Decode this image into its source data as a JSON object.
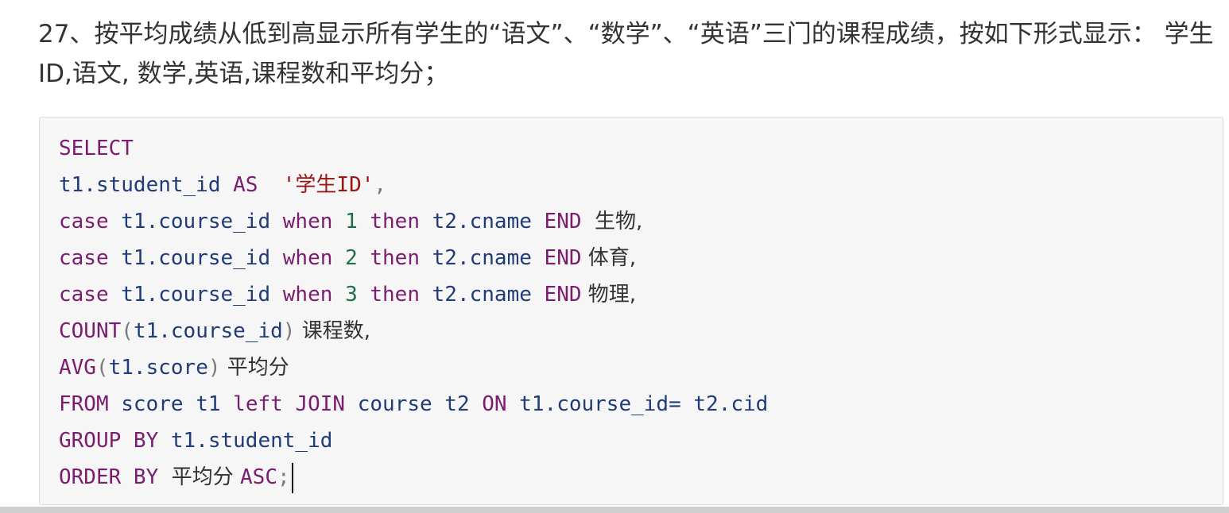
{
  "question": {
    "text": "27、按平均成绩从低到高显示所有学生的“语文”、“数学”、“英语”三门的课程成绩，按如下形式显示： 学生ID,语文, 数学,英语,课程数和平均分；"
  },
  "code": {
    "lines": [
      [
        {
          "t": "SELECT",
          "c": "kw"
        }
      ],
      [
        {
          "t": "t1.student_id ",
          "c": "id"
        },
        {
          "t": "AS",
          "c": "kw"
        },
        {
          "t": "  ",
          "c": "id"
        },
        {
          "t": "'学生ID'",
          "c": "str"
        },
        {
          "t": ",",
          "c": "p"
        }
      ],
      [
        {
          "t": "case",
          "c": "kw"
        },
        {
          "t": " t1.course_id ",
          "c": "id"
        },
        {
          "t": "when",
          "c": "kw"
        },
        {
          "t": " ",
          "c": "id"
        },
        {
          "t": "1",
          "c": "num"
        },
        {
          "t": " ",
          "c": "id"
        },
        {
          "t": "then",
          "c": "kw"
        },
        {
          "t": " t2.cname ",
          "c": "id"
        },
        {
          "t": "END",
          "c": "kw"
        },
        {
          "t": "  生物,",
          "c": "txt"
        }
      ],
      [
        {
          "t": "case",
          "c": "kw"
        },
        {
          "t": " t1.course_id ",
          "c": "id"
        },
        {
          "t": "when",
          "c": "kw"
        },
        {
          "t": " ",
          "c": "id"
        },
        {
          "t": "2",
          "c": "num"
        },
        {
          "t": " ",
          "c": "id"
        },
        {
          "t": "then",
          "c": "kw"
        },
        {
          "t": " t2.cname ",
          "c": "id"
        },
        {
          "t": "END",
          "c": "kw"
        },
        {
          "t": " 体育,",
          "c": "txt"
        }
      ],
      [
        {
          "t": "case",
          "c": "kw"
        },
        {
          "t": " t1.course_id ",
          "c": "id"
        },
        {
          "t": "when",
          "c": "kw"
        },
        {
          "t": " ",
          "c": "id"
        },
        {
          "t": "3",
          "c": "num"
        },
        {
          "t": " ",
          "c": "id"
        },
        {
          "t": "then",
          "c": "kw"
        },
        {
          "t": " t2.cname ",
          "c": "id"
        },
        {
          "t": "END",
          "c": "kw"
        },
        {
          "t": " 物理,",
          "c": "txt"
        }
      ],
      [
        {
          "t": "COUNT",
          "c": "kw"
        },
        {
          "t": "(",
          "c": "p"
        },
        {
          "t": "t1.course_id",
          "c": "id"
        },
        {
          "t": ")",
          "c": "p"
        },
        {
          "t": " 课程数,",
          "c": "txt"
        }
      ],
      [
        {
          "t": "AVG",
          "c": "kw"
        },
        {
          "t": "(",
          "c": "p"
        },
        {
          "t": "t1.score",
          "c": "id"
        },
        {
          "t": ")",
          "c": "p"
        },
        {
          "t": " 平均分",
          "c": "txt"
        }
      ],
      [
        {
          "t": "FROM",
          "c": "kw"
        },
        {
          "t": " score t1 ",
          "c": "id"
        },
        {
          "t": "left",
          "c": "kw"
        },
        {
          "t": " ",
          "c": "id"
        },
        {
          "t": "JOIN",
          "c": "kw"
        },
        {
          "t": " course t2 ",
          "c": "id"
        },
        {
          "t": "ON",
          "c": "kw"
        },
        {
          "t": " t1.course_id= t2.cid",
          "c": "id"
        }
      ],
      [
        {
          "t": "GROUP BY",
          "c": "kw"
        },
        {
          "t": " t1.student_id",
          "c": "id"
        }
      ],
      [
        {
          "t": "ORDER BY",
          "c": "kw"
        },
        {
          "t": "  平均分 ",
          "c": "txt"
        },
        {
          "t": "ASC",
          "c": "kw"
        },
        {
          "t": ";",
          "c": "p"
        }
      ]
    ]
  },
  "colors": {
    "keyword": "#7b1c6e",
    "identifier": "#1f3c78",
    "string": "#9a1515",
    "number": "#1f6e4a",
    "background": "#f6f6f7"
  }
}
